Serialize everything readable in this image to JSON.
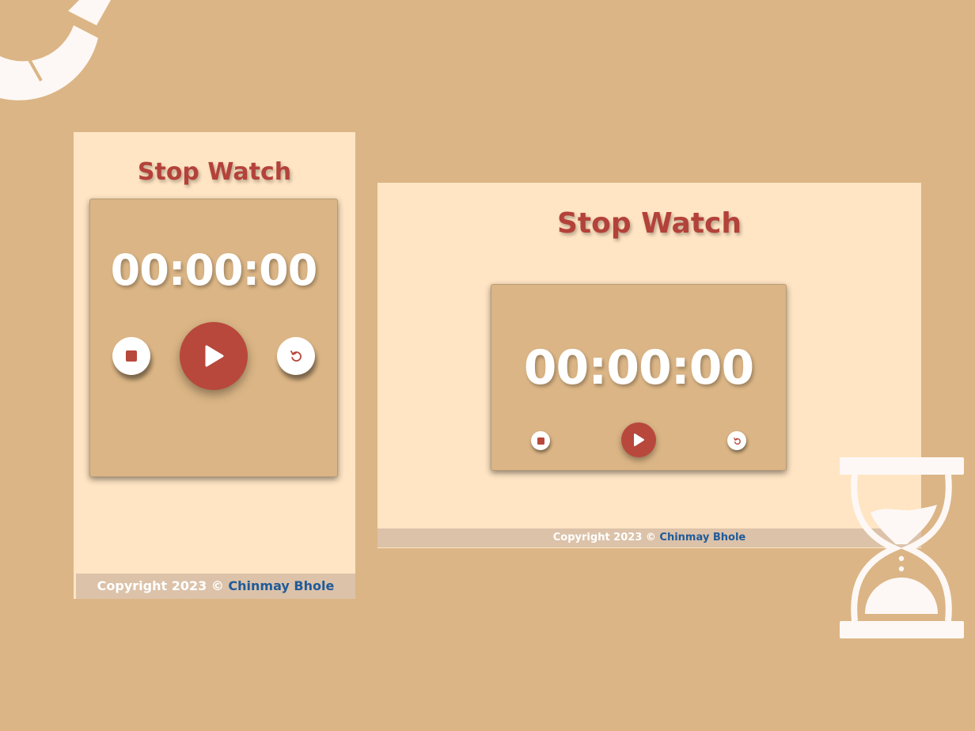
{
  "mobile": {
    "title": "Stop Watch",
    "time": "00:00:00",
    "footer": {
      "text": "Copyright 2023 © ",
      "author": "Chinmay Bhole"
    }
  },
  "desktop": {
    "title": "Stop Watch",
    "time": "00:00:00",
    "footer": {
      "text": "Copyright 2023 © ",
      "author": "Chinmay Bhole"
    }
  },
  "icons": {
    "stop": "stop-icon",
    "play": "play-icon",
    "reset": "reset-icon",
    "hourglass": "hourglass-icon",
    "ring": "segmented-ring-decoration"
  },
  "colors": {
    "background": "#dbb585",
    "panel": "#ffe5c3",
    "accent": "#b8473c",
    "footer_bar": "#dbc2a8",
    "link": "#1f5a9a"
  }
}
